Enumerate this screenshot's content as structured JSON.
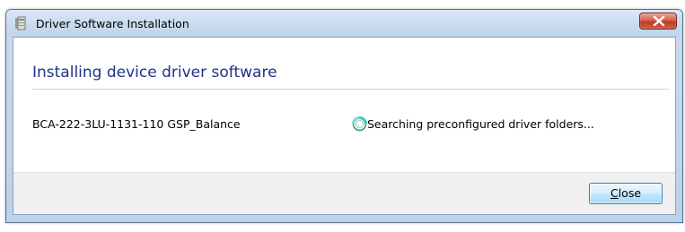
{
  "window": {
    "title": "Driver Software Installation"
  },
  "main": {
    "heading": "Installing device driver software",
    "device": {
      "name": "BCA-222-3LU-1131-110 GSP_Balance",
      "status": "Searching preconfigured driver folders...",
      "status_icon": "busy-spinner-icon"
    }
  },
  "footer": {
    "close_label_accel": "C",
    "close_label_rest": "lose"
  },
  "icons": {
    "app": "driver-install-icon",
    "titlebar_close": "close-icon"
  },
  "colors": {
    "heading": "#1e3287",
    "titlebar_close": "#c23a24",
    "button_border": "#3c7fb1"
  }
}
